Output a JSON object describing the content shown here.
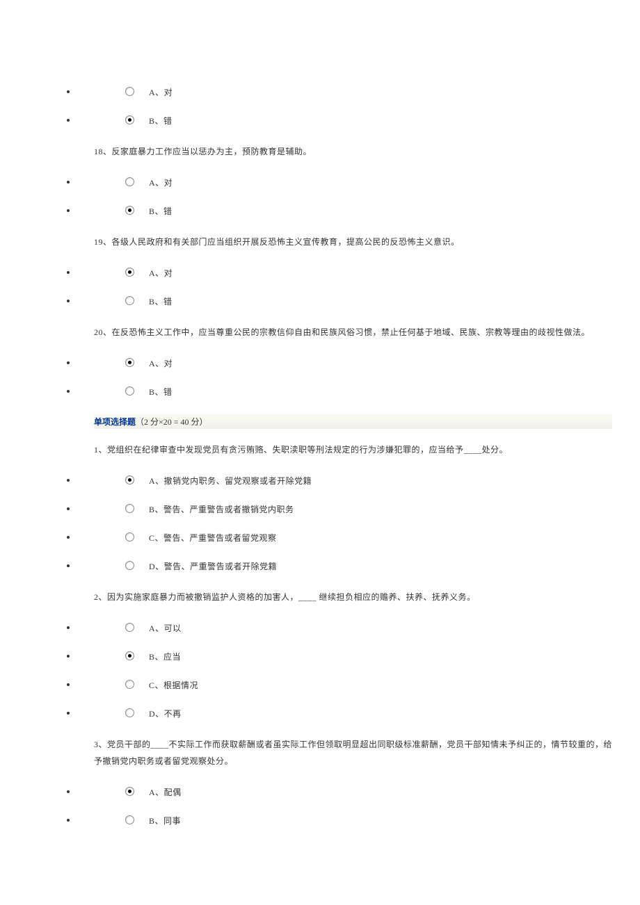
{
  "questions_tf": [
    {
      "id": "q17",
      "text": "",
      "options": [
        {
          "label": "A、对",
          "selected": false
        },
        {
          "label": "B、错",
          "selected": true
        }
      ]
    },
    {
      "id": "q18",
      "text": "18、反家庭暴力工作应当以惩办为主，预防教育是辅助。",
      "options": [
        {
          "label": "A、对",
          "selected": false
        },
        {
          "label": "B、错",
          "selected": true
        }
      ]
    },
    {
      "id": "q19",
      "text": "19、各级人民政府和有关部门应当组织开展反恐怖主义宣传教育，提高公民的反恐怖主义意识。",
      "options": [
        {
          "label": "A、对",
          "selected": true
        },
        {
          "label": "B、错",
          "selected": false
        }
      ]
    },
    {
      "id": "q20",
      "text": "20、在反恐怖主义工作中，应当尊重公民的宗教信仰自由和民族风俗习惯，禁止任何基于地域、民族、宗教等理由的歧视性做法。",
      "options": [
        {
          "label": "A、对",
          "selected": true
        },
        {
          "label": "B、错",
          "selected": false
        }
      ]
    }
  ],
  "section": {
    "title": "单项选择题",
    "scoring": "（2 分×20 = 40 分）"
  },
  "questions_mc": [
    {
      "id": "m1",
      "text": "1、党组织在纪律审查中发现党员有贪污贿赂、失职渎职等刑法规定的行为涉嫌犯罪的，应当给予____处分。",
      "options": [
        {
          "label": "A、撤销党内职务、留党观察或者开除党籍",
          "selected": true
        },
        {
          "label": "B、警告、严重警告或者撤销党内职务",
          "selected": false
        },
        {
          "label": "C、警告、严重警告或者留党观察",
          "selected": false
        },
        {
          "label": "D、警告、严重警告或者开除党籍",
          "selected": false
        }
      ]
    },
    {
      "id": "m2",
      "text": "2、因为实施家庭暴力而被撤销监护人资格的加害人，____ 继续担负相应的赡养、扶养、抚养义务。",
      "options": [
        {
          "label": "A、可以",
          "selected": false
        },
        {
          "label": "B、应当",
          "selected": true
        },
        {
          "label": "C、根据情况",
          "selected": false
        },
        {
          "label": "D、不再",
          "selected": false
        }
      ]
    },
    {
      "id": "m3",
      "text": "3、党员干部的____不实际工作而获取薪酬或者虽实际工作但领取明显超出同职级标准薪酬，党员干部知情未予纠正的，情节较重的，给予撤销党内职务或者留党观察处分。",
      "options": [
        {
          "label": "A、配偶",
          "selected": true
        },
        {
          "label": "B、同事",
          "selected": false
        }
      ]
    }
  ]
}
